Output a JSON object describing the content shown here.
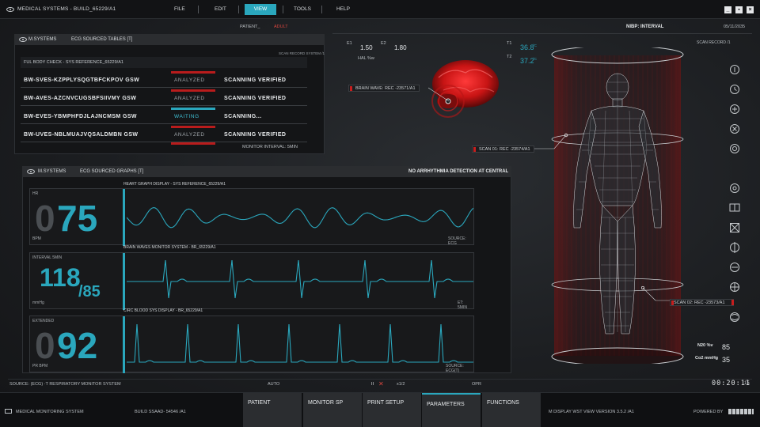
{
  "window": {
    "title": "MEDICAL SYSTEMS - BUILD_65229/A1",
    "menu": [
      "FILE",
      "EDIT",
      "VIEW",
      "TOOLS",
      "HELP"
    ],
    "active_menu": "VIEW"
  },
  "header": {
    "patient_label": "PATIENT_",
    "patient_type": "ADULT",
    "nibp": "NIBP: INTERVAL",
    "date": "05/11/2035",
    "scan_record_left": "SCAN RECORD SYSTEM /1",
    "scan_record_right": "SCAN RECORD /1"
  },
  "tables_panel": {
    "system": "M.SYSTEMS",
    "title": "ECG SOURCED TABLES [T]",
    "subtitle": "FUL BODY CHECK - SYS REFERENCE_65229/A1",
    "rows": [
      {
        "code": "BW-SVES-KZPPLYSQGTBFCKPOV GSW",
        "state": "ANALYZED",
        "result": "SCANNING VERIFIED"
      },
      {
        "code": "BW-AVES-AZCNVCUGSBFSIIVMY GSW",
        "state": "ANALYZED",
        "result": "SCANNING VERIFIED"
      },
      {
        "code": "BW-EVES-YBMPHFDJLAJNCMSM GSW",
        "state": "WAITING",
        "result": "SCANNING..."
      },
      {
        "code": "BW-UVES-NBLMUAJVQSALDMBN GSW",
        "state": "ANALYZED",
        "result": "SCANNING VERIFIED"
      }
    ],
    "footer": "MONITOR INTERVAL: 5MIN"
  },
  "graphs_panel": {
    "system": "M.SYSTEMS",
    "title": "ECG SOURCED GRAPHS [T]",
    "status": "NO ARRHYTHMIA DETECTION AT CENTRAL",
    "graphs": [
      {
        "heading": "HEART GRAPH DISPLAY - SYS REFERENCE_65229/A1",
        "tl": "HR",
        "bl": "BPM",
        "dim": "0",
        "value": "75",
        "source": "SOURCE: ECG"
      },
      {
        "heading": "BRAIN WAVES MONITOR SYSTEM - BR_65229/A1",
        "tl": "INTERVAL 5MIN",
        "bl": "mmHg",
        "value": "118",
        "value2": "/85",
        "source": "ET: 5MIN"
      },
      {
        "heading": "CIRC BLOOD SYS DISPLAY - BR_65229/A1",
        "tl": "EXTENDED",
        "bl": "PR BPM",
        "dim": "0",
        "value": "92",
        "source": "SOURCE: ECG(T)"
      }
    ]
  },
  "vitals": {
    "e1_label": "E1",
    "e1": "1.50",
    "e2_label": "E2",
    "e2": "1.80",
    "hal": "HAL %w",
    "t1_label": "T1",
    "t1": "36.8",
    "t2_label": "T2",
    "t2": "37.2",
    "deg": "°C"
  },
  "callouts": {
    "brain": "BRAIN WAVE: REC -23571/A1",
    "scan1": "SCAN 01: REC -23574/A1",
    "scan2": "SCAN 02: REC -23573/A1"
  },
  "gas": {
    "n2o_label": "N20 %v",
    "n2o": "85",
    "co2_label": "Co2 mmHg",
    "co2": "35"
  },
  "status_row": {
    "source": "SOURCE: (ECG) ·T   RESPIRATORY MONITOR SYSTEM",
    "auto": "AUTO",
    "pause": "II",
    "speed": "x1/2",
    "opr": "OPR",
    "time": "00:20:11",
    "time_small": "15"
  },
  "bottom": {
    "system": "MEDICAL MONITORING SYSTEM",
    "build": "BUILD SSAAD- 54546  /A1",
    "tabs": [
      "PATIENT",
      "MONITOR SP",
      "PRINT SETUP",
      "PARAMETERS",
      "FUNCTIONS"
    ],
    "active_tab": "PARAMETERS",
    "version": "M DISPLAY WST VIEW  VERSION 3.5.2 /A1",
    "powered": "POWERED BY"
  },
  "colors": {
    "accent": "#2aa7bd",
    "alert": "#c81e1e"
  },
  "icons": [
    "info-icon",
    "clock-icon",
    "plus-icon",
    "close-circle-icon",
    "settings-icon",
    "target-icon",
    "split-icon",
    "cross-box-icon",
    "vertical-line-icon",
    "minus-icon",
    "crosshair-icon",
    "globe-icon"
  ]
}
